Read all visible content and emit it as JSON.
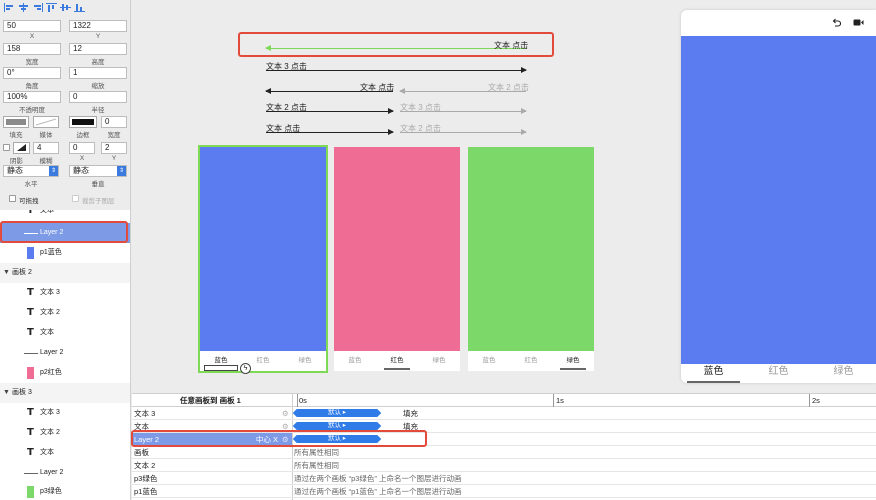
{
  "inspector": {
    "x": "50",
    "y": "1322",
    "x_label": "X",
    "y_label": "Y",
    "width": "158",
    "height": "12",
    "width_label": "宽度",
    "height_label": "高度",
    "angle": "0°",
    "scale": "1",
    "angle_label": "角度",
    "scale_label": "缩放",
    "opacity": "100%",
    "radius": "0",
    "opacity_label": "不透明度",
    "radius_label": "半径",
    "fill_label": "填充",
    "media_label": "媒体",
    "border_label": "边框",
    "border_width": "0",
    "border_width_label": "宽度",
    "shadow_label": "阴影",
    "blur": "4",
    "blur_label": "模糊",
    "shadow_x": "0",
    "shadow_y": "2",
    "shadow_x_label": "X",
    "shadow_y_label": "Y",
    "h_mode": "静态",
    "v_mode": "静态",
    "h_label": "水平",
    "v_label": "垂直",
    "scrollable_label": "可拖拽",
    "clip_label": "裁剪子图层"
  },
  "layers": [
    {
      "kind": "text",
      "name": "文本",
      "partial": true
    },
    {
      "kind": "line",
      "name": "Layer 2",
      "selected": true
    },
    {
      "kind": "square",
      "name": "p1蓝色",
      "color": "#5b7cf0"
    },
    {
      "kind": "group",
      "name": "画板 2"
    },
    {
      "kind": "text",
      "name": "文本 3"
    },
    {
      "kind": "text",
      "name": "文本 2"
    },
    {
      "kind": "text",
      "name": "文本"
    },
    {
      "kind": "line",
      "name": "Layer 2"
    },
    {
      "kind": "square",
      "name": "p2红色",
      "color": "#ef6c95"
    },
    {
      "kind": "group",
      "name": "画板 3"
    },
    {
      "kind": "text",
      "name": "文本 3"
    },
    {
      "kind": "text",
      "name": "文本 2"
    },
    {
      "kind": "text",
      "name": "文本"
    },
    {
      "kind": "line",
      "name": "Layer 2"
    },
    {
      "kind": "square",
      "name": "p3绿色",
      "color": "#7dd86a"
    }
  ],
  "canvas": {
    "arrows": {
      "a1": "文本 点击",
      "a2": "文本 3 点击",
      "a3_left": "文本 点击",
      "a3_right": "文本 2 点击",
      "a4_left": "文本 2 点击",
      "a4_right": "文本 3 点击",
      "a5_left": "文本 点击",
      "a5_right": "文本 2 点击"
    },
    "cards": [
      {
        "color": "#5b7cf0",
        "tabs": [
          "蓝色",
          "红色",
          "绿色"
        ],
        "active": 0
      },
      {
        "color": "#ef6c95",
        "tabs": [
          "蓝色",
          "红色",
          "绿色"
        ],
        "active": 1
      },
      {
        "color": "#7dd86a",
        "tabs": [
          "蓝色",
          "红色",
          "绿色"
        ],
        "active": 2
      }
    ],
    "phone": {
      "color": "#5b7cf0",
      "tabs": [
        "蓝色",
        "红色",
        "绿色"
      ],
      "active": 0
    }
  },
  "timeline": {
    "header": "任意画板到 画板 1",
    "ticks": [
      "0s",
      "1s",
      "2s"
    ],
    "rows": [
      {
        "name": "文本 3",
        "prop": "填充",
        "segment": "默认"
      },
      {
        "name": "文本",
        "prop": "填充",
        "segment": "默认"
      },
      {
        "name": "Layer 2",
        "prop": "中心 X",
        "segment": "默认",
        "selected": true
      },
      {
        "name": "画板",
        "msg": "所有属性相同"
      },
      {
        "name": "文本 2",
        "msg": "所有属性相同"
      },
      {
        "name": "p3绿色",
        "msg": "通过在两个画板 “p3绿色” 上命名一个图层进行动画"
      },
      {
        "name": "p1蓝色",
        "msg": "通过在两个画板 “p1蓝色” 上命名一个图层进行动画"
      }
    ]
  },
  "colors": {
    "accent": "#3b7be0",
    "highlight": "#e24b3b",
    "selection": "#7d9ae6"
  }
}
